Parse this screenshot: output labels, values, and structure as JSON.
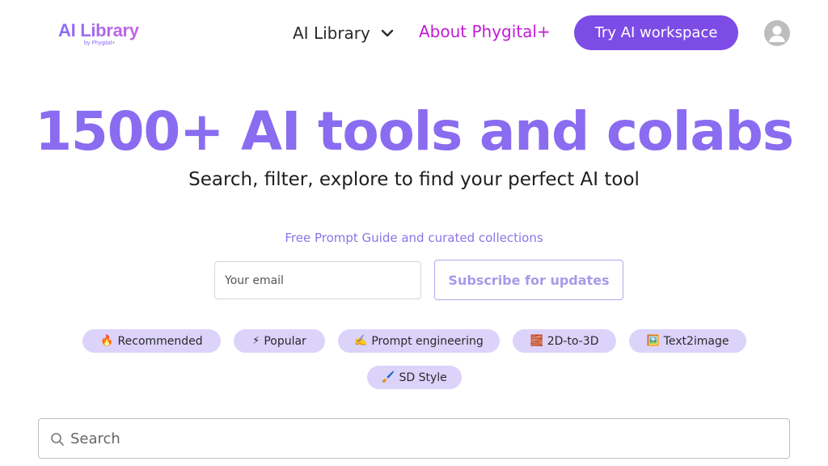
{
  "header": {
    "logo": {
      "title": "AI Library",
      "subtitle": "by Phygital+"
    },
    "nav_menu": {
      "label": "AI Library",
      "icon": "chevron-down-icon"
    },
    "nav_link": {
      "label": "About Phygital+",
      "color": "#c21bd6"
    },
    "cta": {
      "label": "Try AI workspace",
      "color": "#7d4be6"
    },
    "avatar": {
      "icon": "user-avatar-icon"
    }
  },
  "hero": {
    "title": "1500+ AI tools and colabs",
    "subtitle": "Search, filter, explore to find your perfect AI tool",
    "title_color": "#8a6cf0"
  },
  "subscribe": {
    "promo": "Free Prompt Guide and curated collections",
    "email_placeholder": "Your email",
    "button_label": "Subscribe for updates"
  },
  "tags": [
    {
      "emoji": "🔥",
      "label": "Recommended"
    },
    {
      "emoji": "⚡",
      "label": "Popular"
    },
    {
      "emoji": "✍️",
      "label": "Prompt engineering"
    },
    {
      "emoji": "🧱",
      "label": "2D-to-3D"
    },
    {
      "emoji": "🖼️",
      "label": "Text2image"
    },
    {
      "emoji": "🖌️",
      "label": "SD Style"
    }
  ],
  "search": {
    "placeholder": "Search",
    "icon": "search-icon"
  }
}
